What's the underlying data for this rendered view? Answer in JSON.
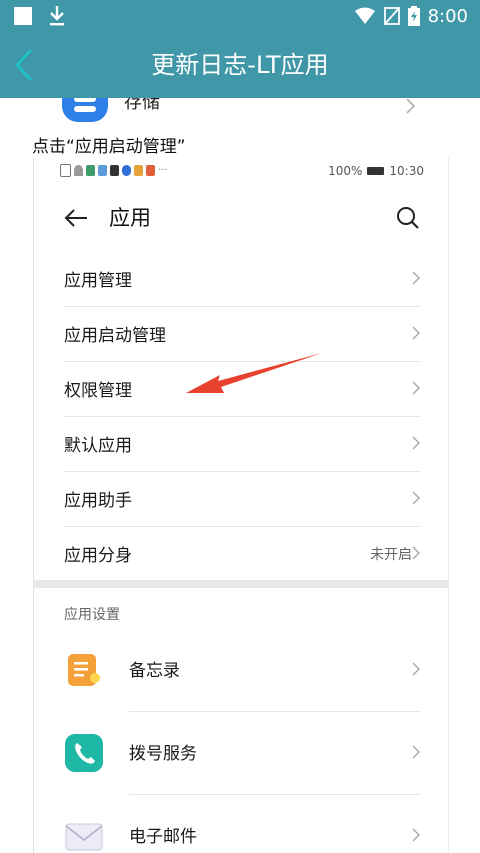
{
  "status_bar": {
    "time": "8:00"
  },
  "app_bar": {
    "title": "更新日志-LT应用"
  },
  "storage": {
    "label": "存储"
  },
  "instruction": "点击“应用启动管理”",
  "phone": {
    "status": {
      "battery": "100%",
      "time": "10:30"
    },
    "header": {
      "title": "应用"
    },
    "menu": [
      {
        "label": "应用管理",
        "value": ""
      },
      {
        "label": "应用启动管理",
        "value": ""
      },
      {
        "label": "权限管理",
        "value": ""
      },
      {
        "label": "默认应用",
        "value": ""
      },
      {
        "label": "应用助手",
        "value": ""
      },
      {
        "label": "应用分身",
        "value": "未开启"
      }
    ],
    "section_header": "应用设置",
    "apps": [
      {
        "label": "备忘录",
        "icon": "notes-icon",
        "color": "#f5a13a"
      },
      {
        "label": "拨号服务",
        "icon": "phone-icon",
        "color": "#1fb8a6"
      },
      {
        "label": "电子邮件",
        "icon": "email-icon",
        "color": "#c9c9e0"
      }
    ]
  },
  "colors": {
    "primary": "#3f97a8",
    "arrow": "#e8412e"
  }
}
